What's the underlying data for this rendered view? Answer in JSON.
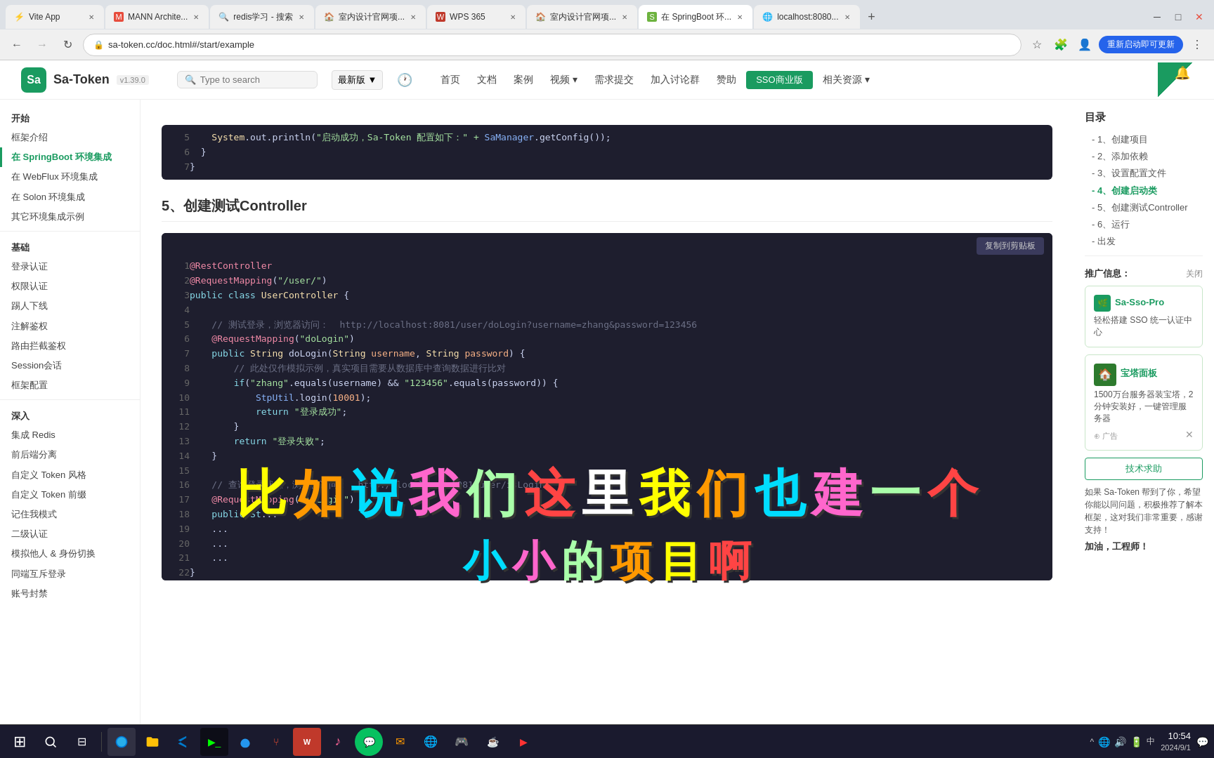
{
  "browser": {
    "tabs": [
      {
        "id": "vite",
        "title": "Vite App",
        "active": false,
        "favicon": "⚡"
      },
      {
        "id": "mann",
        "title": "MANN Archite...",
        "active": false,
        "favicon": "M"
      },
      {
        "id": "redis",
        "title": "redis学习 - 搜索",
        "active": false,
        "favicon": "🔍"
      },
      {
        "id": "interior1",
        "title": "室内设计官网项...",
        "active": false,
        "favicon": "🏠"
      },
      {
        "id": "wps",
        "title": "WPS 365",
        "active": false,
        "favicon": "W"
      },
      {
        "id": "interior2",
        "title": "室内设计官网项...",
        "active": false,
        "favicon": "🏠"
      },
      {
        "id": "springboot",
        "title": "在 SpringBoot 环...",
        "active": true,
        "favicon": "S"
      },
      {
        "id": "localhost",
        "title": "localhost:8080...",
        "active": false,
        "favicon": "L"
      }
    ],
    "url": "sa-token.cc/doc.html#/start/example",
    "update_btn": "重新启动即可更新"
  },
  "site": {
    "logo_icon": "Sa",
    "logo_text": "Sa-Token",
    "logo_version": "v1.39.0",
    "search_placeholder": "Type to search",
    "version_selector": "最新版",
    "nav_items": [
      "首页",
      "文档",
      "案例",
      "视频",
      "需求提交",
      "加入讨论群",
      "赞助",
      "SSO商业版",
      "相关资源"
    ],
    "nav_arrow_items": [
      "视频",
      "相关资源"
    ]
  },
  "sidebar": {
    "sections": [
      {
        "title": "开始",
        "items": [
          {
            "label": "框架介绍",
            "active": false
          },
          {
            "label": "在 SpringBoot 环境集成",
            "active": true
          },
          {
            "label": "在 WebFlux 环境集成",
            "active": false
          },
          {
            "label": "在 Solon 环境集成",
            "active": false
          },
          {
            "label": "其它环境集成示例",
            "active": false
          }
        ]
      },
      {
        "title": "基础",
        "items": [
          {
            "label": "登录认证",
            "active": false
          },
          {
            "label": "权限认证",
            "active": false
          },
          {
            "label": "踢人下线",
            "active": false
          },
          {
            "label": "注解鉴权",
            "active": false
          },
          {
            "label": "路由拦截鉴权",
            "active": false
          },
          {
            "label": "Session会话",
            "active": false
          },
          {
            "label": "框架配置",
            "active": false
          }
        ]
      },
      {
        "title": "深入",
        "items": [
          {
            "label": "集成 Redis",
            "active": false
          },
          {
            "label": "前后端分离",
            "active": false
          },
          {
            "label": "自定义 Token 风格",
            "active": false
          },
          {
            "label": "自定义 Token 前缀",
            "active": false
          },
          {
            "label": "记住我模式",
            "active": false
          },
          {
            "label": "二级认证",
            "active": false
          },
          {
            "label": "模拟他人 & 身份切换",
            "active": false
          },
          {
            "label": "同端互斥登录",
            "active": false
          },
          {
            "label": "账号封禁",
            "active": false
          }
        ]
      }
    ]
  },
  "toc": {
    "title": "目录",
    "items": [
      {
        "label": "- 1、创建项目",
        "active": false
      },
      {
        "label": "- 2、添加依赖",
        "active": false
      },
      {
        "label": "- 3、设置配置文件",
        "active": false
      },
      {
        "label": "- 4、创建启动类",
        "active": true
      },
      {
        "label": "- 5、创建测试Controller",
        "active": false
      },
      {
        "label": "- 6、运行",
        "active": false
      },
      {
        "label": "- 出发",
        "active": false
      }
    ]
  },
  "promo": {
    "info_label": "推广信息：",
    "close_label": "关闭",
    "sso_title": "Sa-Sso-Pro",
    "sso_desc": "轻松搭建 SSO 统一认证中心",
    "baota_title": "宝塔面板",
    "baota_desc": "1500万台服务器装宝塔，2分钟安装好，一键管理服务器",
    "ad_label": "广告",
    "tech_help": "技术求助",
    "encouragement": "如果 Sa-Token 帮到了你，希望你能以同问题，积极推荐了解本框架，这对我们非常重要，感谢支持！",
    "cheer": "加油，工程师！"
  },
  "content": {
    "section5_title": "5、创建测试Controller",
    "copy_btn": "复制到剪贴板",
    "code_partial": [
      {
        "num": 5,
        "text": "    System.out.println(\"启动成功，Sa-Token 配置如下：\" + SaManager.getConfig());"
      },
      {
        "num": 6,
        "text": "  }"
      },
      {
        "num": 7,
        "text": "}"
      }
    ],
    "code_lines": [
      {
        "num": 1,
        "text": "@RestController"
      },
      {
        "num": 2,
        "text": "@RequestMapping(\"/user/\")"
      },
      {
        "num": 3,
        "text": "public class UserController {"
      },
      {
        "num": 4,
        "text": ""
      },
      {
        "num": 5,
        "text": "    // 测试登录，浏览器访问：  http://localhost:8081/user/doLogin?username=zhang&password=123456"
      },
      {
        "num": 6,
        "text": "    @RequestMapping(\"doLogin\")"
      },
      {
        "num": 7,
        "text": "    public String doLogin(String username, String password) {"
      },
      {
        "num": 8,
        "text": "        // 此处仅作模拟示例，真实项目需要从数据库中查询数据进行比对"
      },
      {
        "num": 9,
        "text": "        if(\"zhang\".equals(username) && \"123456\".equals(password)) {"
      },
      {
        "num": 10,
        "text": "            StpUtil.login(10001);"
      },
      {
        "num": 11,
        "text": "            return \"登录成功\";"
      },
      {
        "num": 12,
        "text": "        }"
      },
      {
        "num": 13,
        "text": "        return \"登录失败\";"
      },
      {
        "num": 14,
        "text": "    }"
      },
      {
        "num": 15,
        "text": ""
      },
      {
        "num": 16,
        "text": "    // 查询登录状态，浏览器访问：  http://localhost:8081/user/isLogin"
      },
      {
        "num": 17,
        "text": "    @RequestMapping(\"isLogin\")"
      },
      {
        "num": 18,
        "text": "    public St..."
      },
      {
        "num": 19,
        "text": "    ..."
      },
      {
        "num": 20,
        "text": "    ..."
      },
      {
        "num": 21,
        "text": "    ..."
      },
      {
        "num": 22,
        "text": "}"
      }
    ]
  },
  "subtitle": {
    "line1": [
      "比",
      "如",
      "说",
      "我",
      "们",
      "这",
      "里",
      "我",
      "们",
      "也",
      "建",
      "一",
      "个"
    ],
    "line2": [
      "小",
      "小",
      "的",
      "项",
      "目",
      "啊"
    ]
  },
  "taskbar": {
    "time": "10:54",
    "date": "2024/9/1",
    "start_icon": "⊞"
  }
}
